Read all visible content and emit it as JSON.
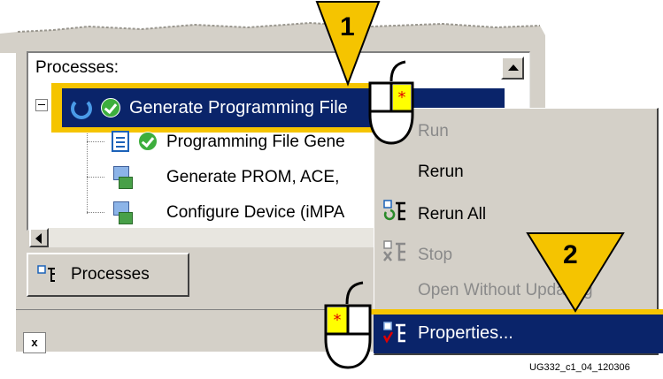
{
  "panel": {
    "section_label": "Processes:",
    "tree_items": [
      {
        "label": "Generate Programming File",
        "selected": true
      },
      {
        "label": "Programming File Gene"
      },
      {
        "label": "Generate PROM, ACE,"
      },
      {
        "label": "Configure Device (iMPA"
      }
    ],
    "tab_label": "Processes",
    "x_label": "x"
  },
  "context_menu": {
    "items": [
      {
        "label": "Run",
        "enabled": false
      },
      {
        "label": "Rerun",
        "enabled": true
      },
      {
        "label": "Rerun All",
        "enabled": true
      },
      {
        "label": "Stop",
        "enabled": false
      },
      {
        "label": "Open Without Updating",
        "enabled": false
      },
      {
        "label": "Properties...",
        "enabled": true,
        "highlighted": true
      }
    ]
  },
  "callouts": [
    "1",
    "2"
  ],
  "caption": "UG332_c1_04_120306",
  "colors": {
    "highlight_blue": "#0a246a",
    "callout_yellow": "#f5c400",
    "panel_gray": "#d4d0c8",
    "mouse_button_yellow": "#ffff00",
    "click_red": "#e00000"
  }
}
